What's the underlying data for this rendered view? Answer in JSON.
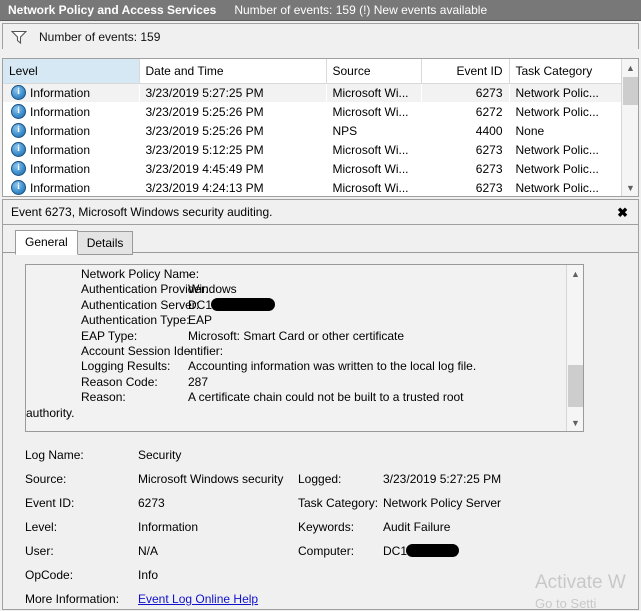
{
  "titlebar": {
    "title": "Network Policy and Access Services",
    "status": "Number of events: 159 (!) New events available"
  },
  "filterbar": {
    "icon": "funnel-filter-icon",
    "text": "Number of events: 159"
  },
  "event_list": {
    "columns": [
      "Level",
      "Date and Time",
      "Source",
      "Event ID",
      "Task Category"
    ],
    "sorted_column": "Level",
    "rows": [
      {
        "level": "Information",
        "datetime": "3/23/2019 5:27:25 PM",
        "source": "Microsoft Wi...",
        "event_id": "6273",
        "task_category": "Network Polic...",
        "selected": true
      },
      {
        "level": "Information",
        "datetime": "3/23/2019 5:25:26 PM",
        "source": "Microsoft Wi...",
        "event_id": "6272",
        "task_category": "Network Polic...",
        "selected": false
      },
      {
        "level": "Information",
        "datetime": "3/23/2019 5:25:26 PM",
        "source": "NPS",
        "event_id": "4400",
        "task_category": "None",
        "selected": false
      },
      {
        "level": "Information",
        "datetime": "3/23/2019 5:12:25 PM",
        "source": "Microsoft Wi...",
        "event_id": "6273",
        "task_category": "Network Polic...",
        "selected": false
      },
      {
        "level": "Information",
        "datetime": "3/23/2019 4:45:49 PM",
        "source": "Microsoft Wi...",
        "event_id": "6273",
        "task_category": "Network Polic...",
        "selected": false
      },
      {
        "level": "Information",
        "datetime": "3/23/2019 4:24:13 PM",
        "source": "Microsoft Wi...",
        "event_id": "6273",
        "task_category": "Network Polic...",
        "selected": false
      }
    ]
  },
  "detail": {
    "header": "Event 6273, Microsoft Windows security auditing.",
    "close_label": "✖",
    "tabs": [
      {
        "label": "General",
        "active": true
      },
      {
        "label": "Details",
        "active": false
      }
    ],
    "message_rows": [
      {
        "key": "Network Policy Name:",
        "value": "-"
      },
      {
        "key": "Authentication Provider:",
        "value": "Windows"
      },
      {
        "key": "Authentication Server:",
        "value": "DC1",
        "redacted": true
      },
      {
        "key": "Authentication Type:",
        "value": "EAP"
      },
      {
        "key": "EAP Type:",
        "value": "Microsoft: Smart Card or other certificate"
      },
      {
        "key": "Account Session Identifier:",
        "value": "-"
      },
      {
        "key": "Logging Results:",
        "value": "Accounting information was written to the local log file."
      },
      {
        "key": "Reason Code:",
        "value": "287"
      },
      {
        "key": "Reason:",
        "value": "A certificate chain could not be built to a trusted root"
      }
    ],
    "message_wrap_line": "authority.",
    "meta": {
      "log_name_label": "Log Name:",
      "log_name_value": "Security",
      "source_label": "Source:",
      "source_value": "Microsoft Windows security",
      "logged_label": "Logged:",
      "logged_value": "3/23/2019 5:27:25 PM",
      "event_id_label": "Event ID:",
      "event_id_value": "6273",
      "task_category_label": "Task Category:",
      "task_category_value": "Network Policy Server",
      "level_label": "Level:",
      "level_value": "Information",
      "keywords_label": "Keywords:",
      "keywords_value": "Audit Failure",
      "user_label": "User:",
      "user_value": "N/A",
      "computer_label": "Computer:",
      "computer_value": "DC1",
      "opcode_label": "OpCode:",
      "opcode_value": "Info",
      "more_info_label": "More Information:",
      "more_info_link": "Event Log Online Help"
    }
  },
  "watermark": {
    "line1": "Activate W",
    "line2": "Go to Setti"
  },
  "colors": {
    "titlebar_bg": "#787878",
    "sorted_header": "#d5e8f4",
    "link": "#1111cc",
    "info_icon": "#3f91cf"
  }
}
